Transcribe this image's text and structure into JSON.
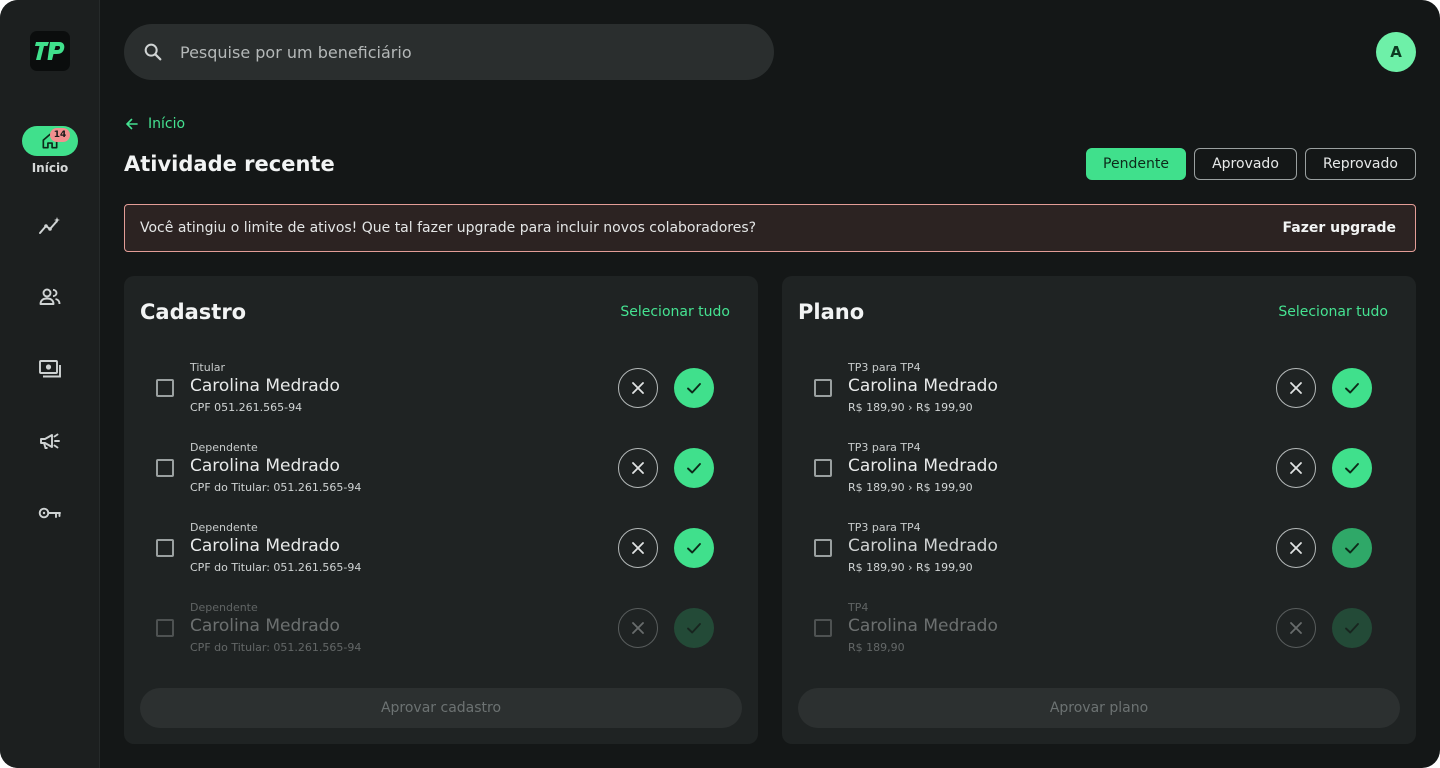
{
  "colors": {
    "accent": "#40e08c",
    "background": "#141717",
    "card": "#1f2323",
    "warning_border": "#e39d97",
    "badge": "#f28f8f"
  },
  "sidebar": {
    "logo_text": "TP",
    "home": {
      "label": "Início",
      "badge": "14",
      "icon": "home-icon"
    },
    "items": [
      {
        "icon": "analytics-icon"
      },
      {
        "icon": "users-icon"
      },
      {
        "icon": "payments-icon"
      },
      {
        "icon": "megaphone-icon"
      },
      {
        "icon": "key-icon"
      }
    ]
  },
  "search": {
    "placeholder": "Pesquise por um beneficiário"
  },
  "user": {
    "avatar_initial": "A"
  },
  "breadcrumb": {
    "label": "Início"
  },
  "page": {
    "title": "Atividade recente"
  },
  "filters": {
    "pending": "Pendente",
    "approved": "Aprovado",
    "rejected": "Reprovado",
    "active": "Pendente"
  },
  "banner": {
    "text": "Você atingiu o limite de ativos! Que tal fazer upgrade para incluir novos colaboradores?",
    "action": "Fazer upgrade"
  },
  "cadastro": {
    "title": "Cadastro",
    "select_all": "Selecionar tudo",
    "rows": [
      {
        "label": "Titular",
        "name": "Carolina Medrado",
        "sub": "CPF 051.261.565-94"
      },
      {
        "label": "Dependente",
        "name": "Carolina Medrado",
        "sub": "CPF do Titular: 051.261.565-94"
      },
      {
        "label": "Dependente",
        "name": "Carolina Medrado",
        "sub": "CPF do Titular: 051.261.565-94"
      },
      {
        "label": "Dependente",
        "name": "Carolina Medrado",
        "sub": "CPF do Titular: 051.261.565-94"
      }
    ],
    "footer_button": "Aprovar cadastro"
  },
  "plano": {
    "title": "Plano",
    "select_all": "Selecionar tudo",
    "rows": [
      {
        "label": "TP3 para TP4",
        "name": "Carolina Medrado",
        "sub": "R$ 189,90 › R$ 199,90"
      },
      {
        "label": "TP3 para TP4",
        "name": "Carolina Medrado",
        "sub": "R$ 189,90 › R$ 199,90"
      },
      {
        "label": "TP3 para TP4",
        "name": "Carolina Medrado",
        "sub": "R$ 189,90 › R$ 199,90"
      },
      {
        "label": "TP4",
        "name": "Carolina Medrado",
        "sub": "R$ 189,90"
      }
    ],
    "footer_button": "Aprovar plano"
  }
}
